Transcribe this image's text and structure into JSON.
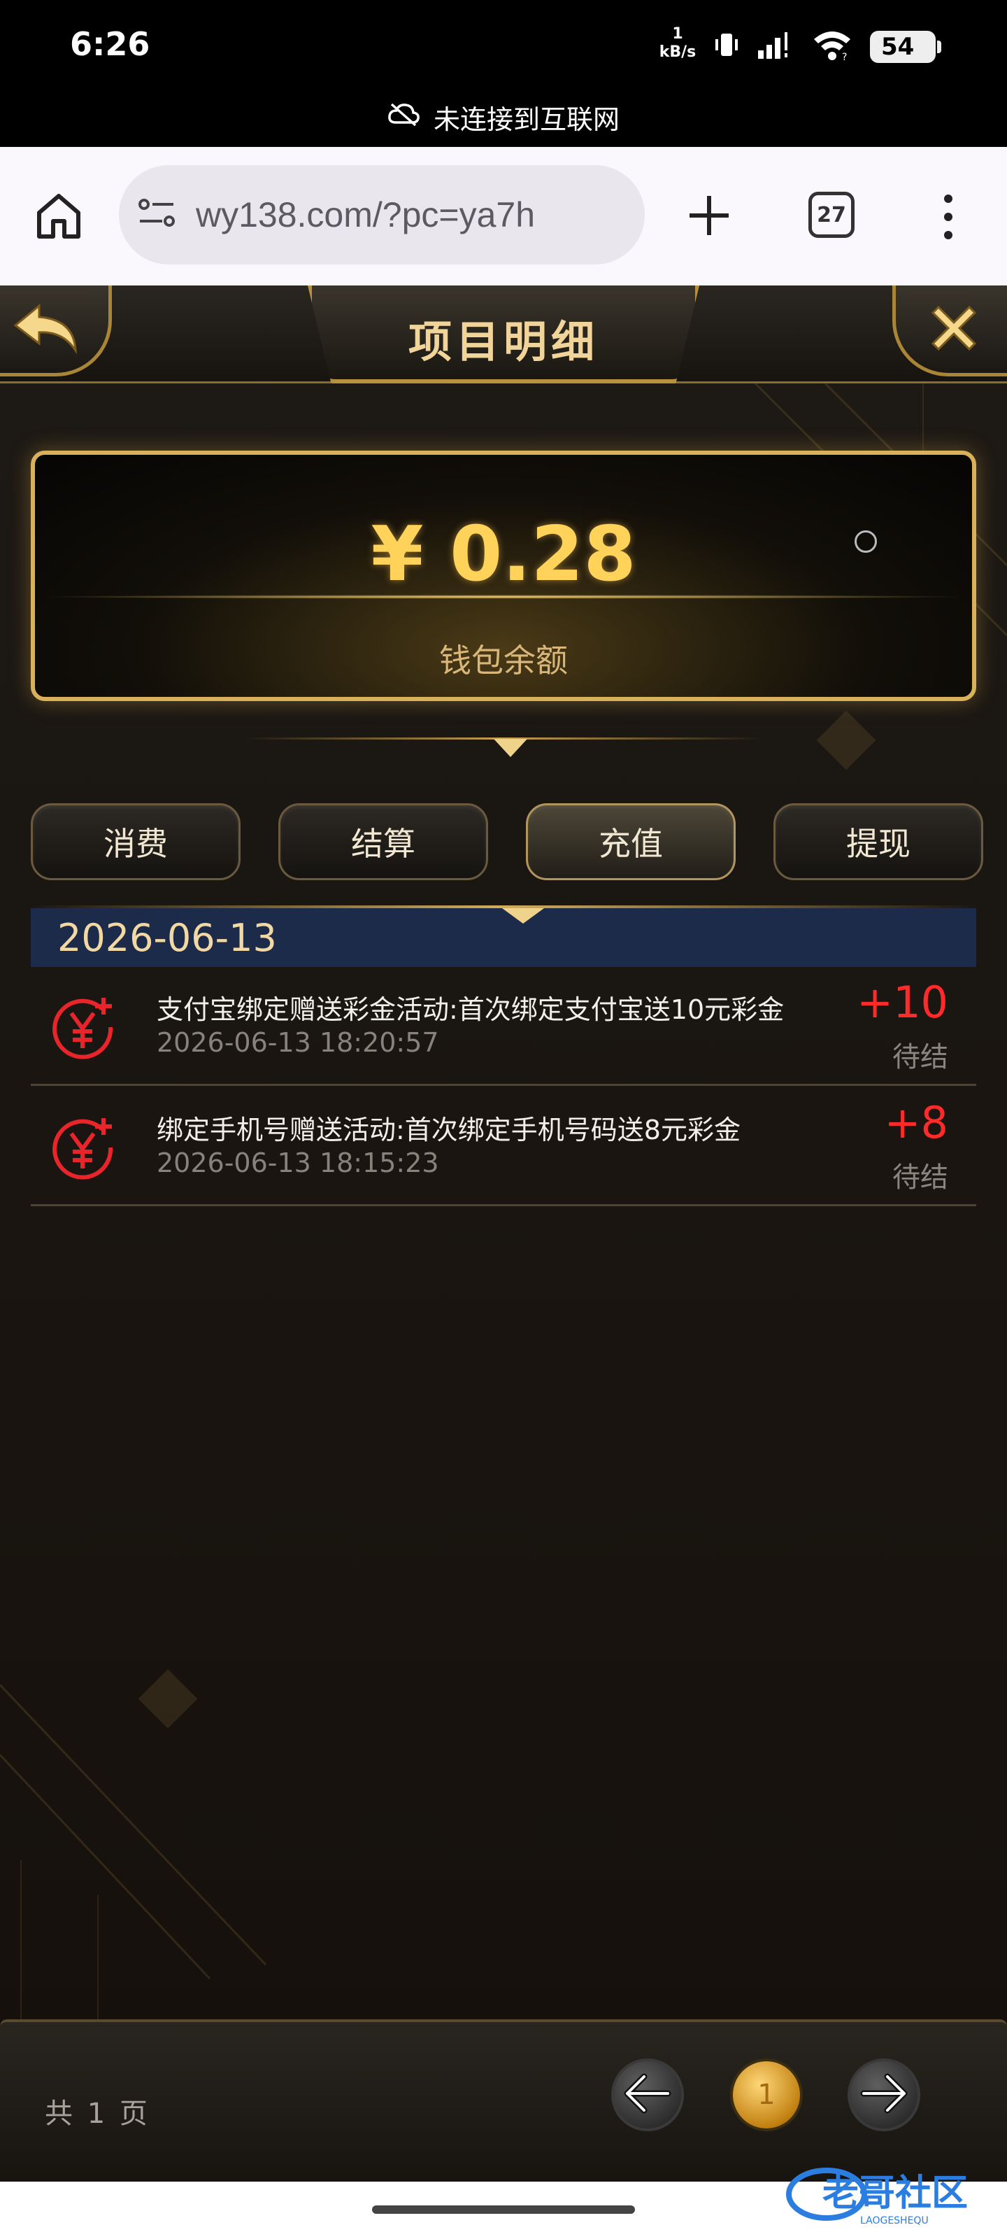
{
  "status_bar": {
    "time": "6:26",
    "net_speed_value": "1",
    "net_speed_unit": "kB/s",
    "battery": "54",
    "offline_text": "未连接到互联网"
  },
  "browser": {
    "url": "wy138.com/?pc=ya7h",
    "tab_count": "27"
  },
  "page": {
    "title": "项目明细",
    "balance_amount": "¥ 0.28",
    "balance_label": "钱包余额",
    "tabs": [
      {
        "label": "消费",
        "active": false
      },
      {
        "label": "结算",
        "active": false
      },
      {
        "label": "充值",
        "active": true
      },
      {
        "label": "提现",
        "active": false
      }
    ],
    "date_group": "2026-06-13",
    "records": [
      {
        "title": "支付宝绑定赠送彩金活动:首次绑定支付宝送10元彩金",
        "time": "2026-06-13 18:20:57",
        "amount": "+10",
        "status": "待结"
      },
      {
        "title": "绑定手机号赠送活动:首次绑定手机号码送8元彩金",
        "time": "2026-06-13 18:15:23",
        "amount": "+8",
        "status": "待结"
      }
    ],
    "footer": {
      "page_info": "共 1 页",
      "current_page": "1"
    }
  },
  "watermark": {
    "text": "老哥社区",
    "sub": "LAOGESHEQU"
  },
  "colors": {
    "accent_gold": "#d8b15a",
    "amount_red": "#ff2a2a",
    "date_bar": "#1d2b4a"
  }
}
